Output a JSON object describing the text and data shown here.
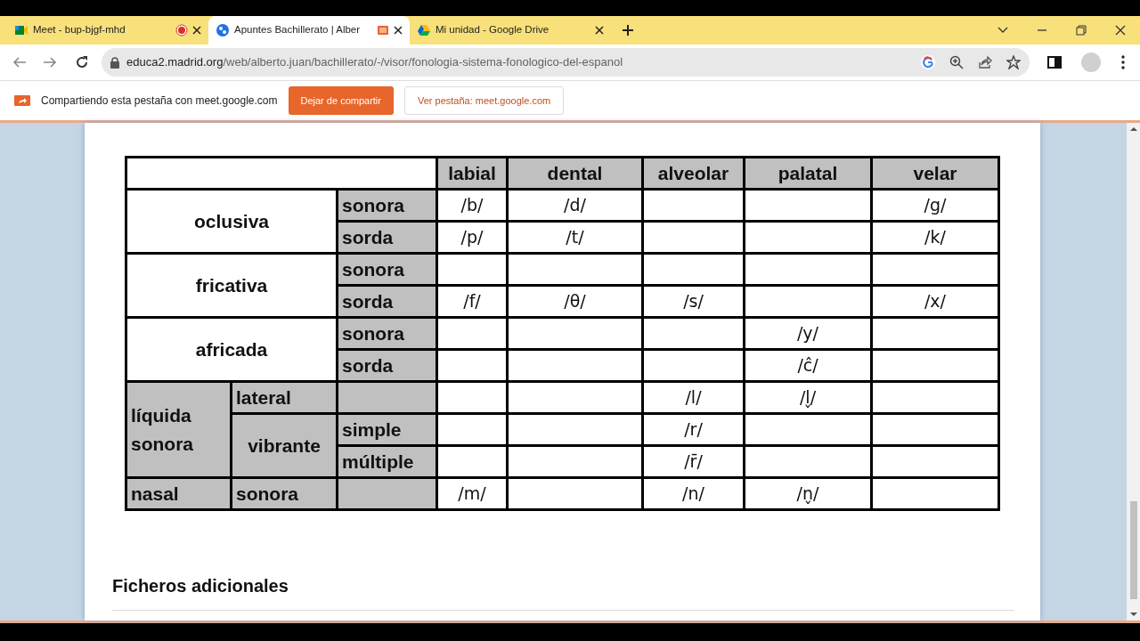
{
  "tabs": [
    {
      "title": "Meet - bup-bjgf-mhd",
      "kind": "meet",
      "recording": true,
      "casting": false,
      "selected": false
    },
    {
      "title": "Apuntes Bachillerato | Alber",
      "kind": "site",
      "recording": false,
      "casting": true,
      "selected": true
    },
    {
      "title": "Mi unidad - Google Drive",
      "kind": "drive",
      "recording": false,
      "casting": false,
      "selected": false
    }
  ],
  "address": {
    "host": "educa2.madrid.org",
    "path": "/web/alberto.juan/bachillerato/-/visor/fonologia-sistema-fonologico-del-espanol"
  },
  "infobar": {
    "message": "Compartiendo esta pestaña con meet.google.com",
    "buttons": [
      {
        "label": "Dejar de compartir",
        "kind": "primary"
      },
      {
        "label": "Ver pestaña: meet.google.com",
        "kind": "outline"
      }
    ]
  },
  "table": {
    "columns": [
      "labial",
      "dental",
      "alveolar",
      "palatal",
      "velar"
    ],
    "groups": [
      {
        "label": "oclusiva",
        "shaded": false,
        "children": [
          {
            "label": "sonora",
            "cells": [
              "/b/",
              "/d/",
              null,
              null,
              "/g/"
            ]
          },
          {
            "label": "sorda",
            "cells": [
              "/p/",
              "/t/",
              null,
              null,
              "/k/"
            ]
          }
        ]
      },
      {
        "label": "fricativa",
        "shaded": false,
        "children": [
          {
            "label": "sonora",
            "cells": [
              null,
              null,
              null,
              null,
              null
            ]
          },
          {
            "label": "sorda",
            "cells": [
              "/f/",
              "/θ/",
              "/s/",
              null,
              "/x/"
            ]
          }
        ]
      },
      {
        "label": "africada",
        "shaded": false,
        "children": [
          {
            "label": "sonora",
            "cells": [
              null,
              null,
              null,
              "/y/",
              null
            ]
          },
          {
            "label": "sorda",
            "cells": [
              null,
              null,
              null,
              "/ĉ/",
              null
            ]
          }
        ]
      },
      {
        "label": "líquida sonora",
        "shaded": true,
        "children": [
          {
            "label": "lateral",
            "shaded": true,
            "children": [
              {
                "cells": [
                  null,
                  null,
                  "/l/",
                  "/l̬/",
                  null
                ]
              }
            ]
          },
          {
            "label": "vibrante",
            "shaded": true,
            "children": [
              {
                "label": "simple",
                "cells": [
                  null,
                  null,
                  "/r/",
                  null,
                  null
                ]
              },
              {
                "label": "múltiple",
                "cells": [
                  null,
                  null,
                  "/r̄/",
                  null,
                  null
                ]
              }
            ]
          }
        ]
      },
      {
        "label": "nasal",
        "shaded": true,
        "children": [
          {
            "label": "sonora",
            "shaded": true,
            "children": [
              {
                "cells": [
                  "/m/",
                  null,
                  "/n/",
                  "/n̬/",
                  null
                ]
              }
            ]
          }
        ]
      }
    ]
  },
  "section_heading": "Ficheros adicionales"
}
